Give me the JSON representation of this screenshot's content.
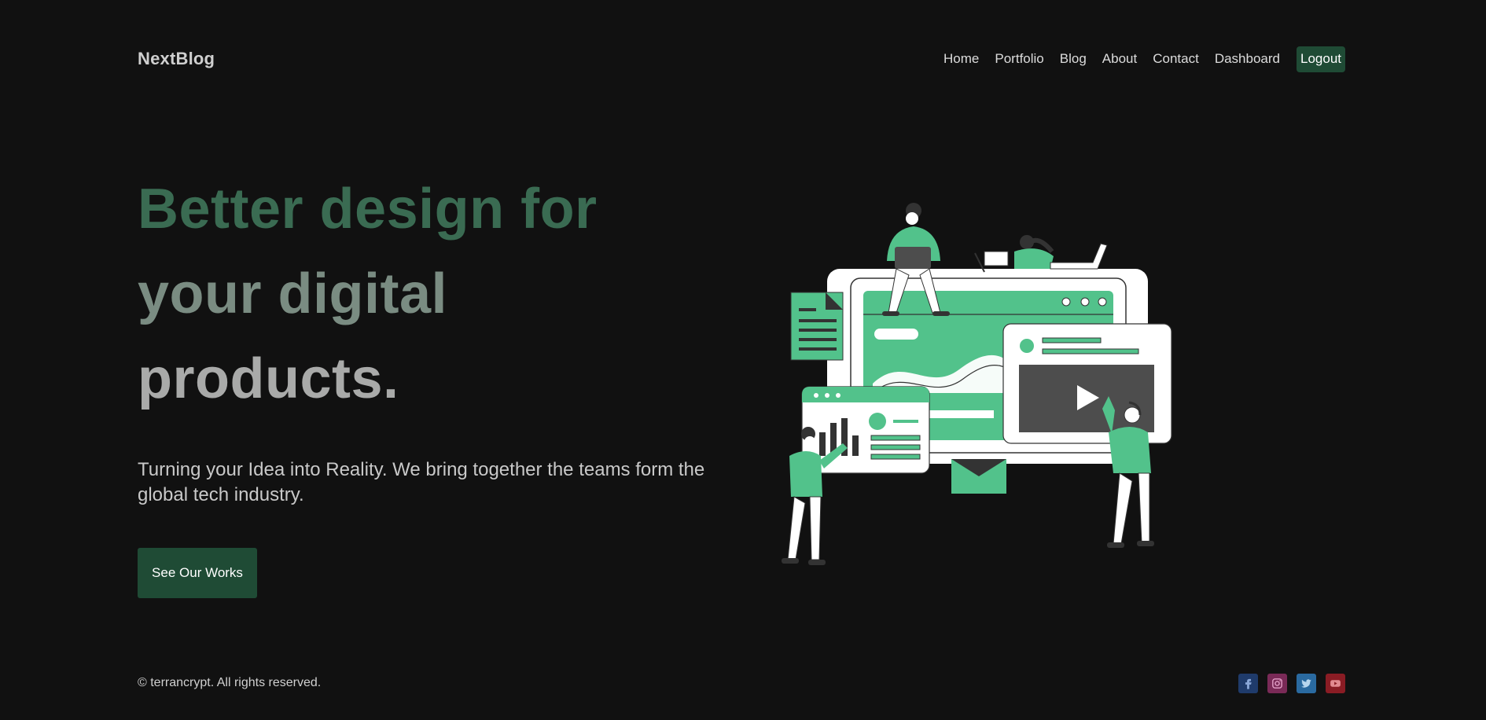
{
  "header": {
    "logo": "NextBlog",
    "nav": [
      "Home",
      "Portfolio",
      "Blog",
      "About",
      "Contact",
      "Dashboard"
    ],
    "logout_label": "Logout"
  },
  "hero": {
    "title_line1": "Better design for",
    "title_line2": "your digital",
    "title_line3": "products.",
    "description": "Turning your Idea into Reality. We bring together the teams form the global tech industry.",
    "cta_label": "See Our Works"
  },
  "footer": {
    "copyright": "© terrancrypt. All rights reserved.",
    "socials": [
      {
        "icon": "facebook-icon",
        "color": "#1f3b6b"
      },
      {
        "icon": "instagram-icon",
        "color": "#7a2a57"
      },
      {
        "icon": "twitter-icon",
        "color": "#2a6aa0"
      },
      {
        "icon": "youtube-icon",
        "color": "#8a1c24"
      }
    ]
  },
  "colors": {
    "background": "#111111",
    "accent_green": "#1f4b35",
    "illustration_green": "#52c28b"
  }
}
